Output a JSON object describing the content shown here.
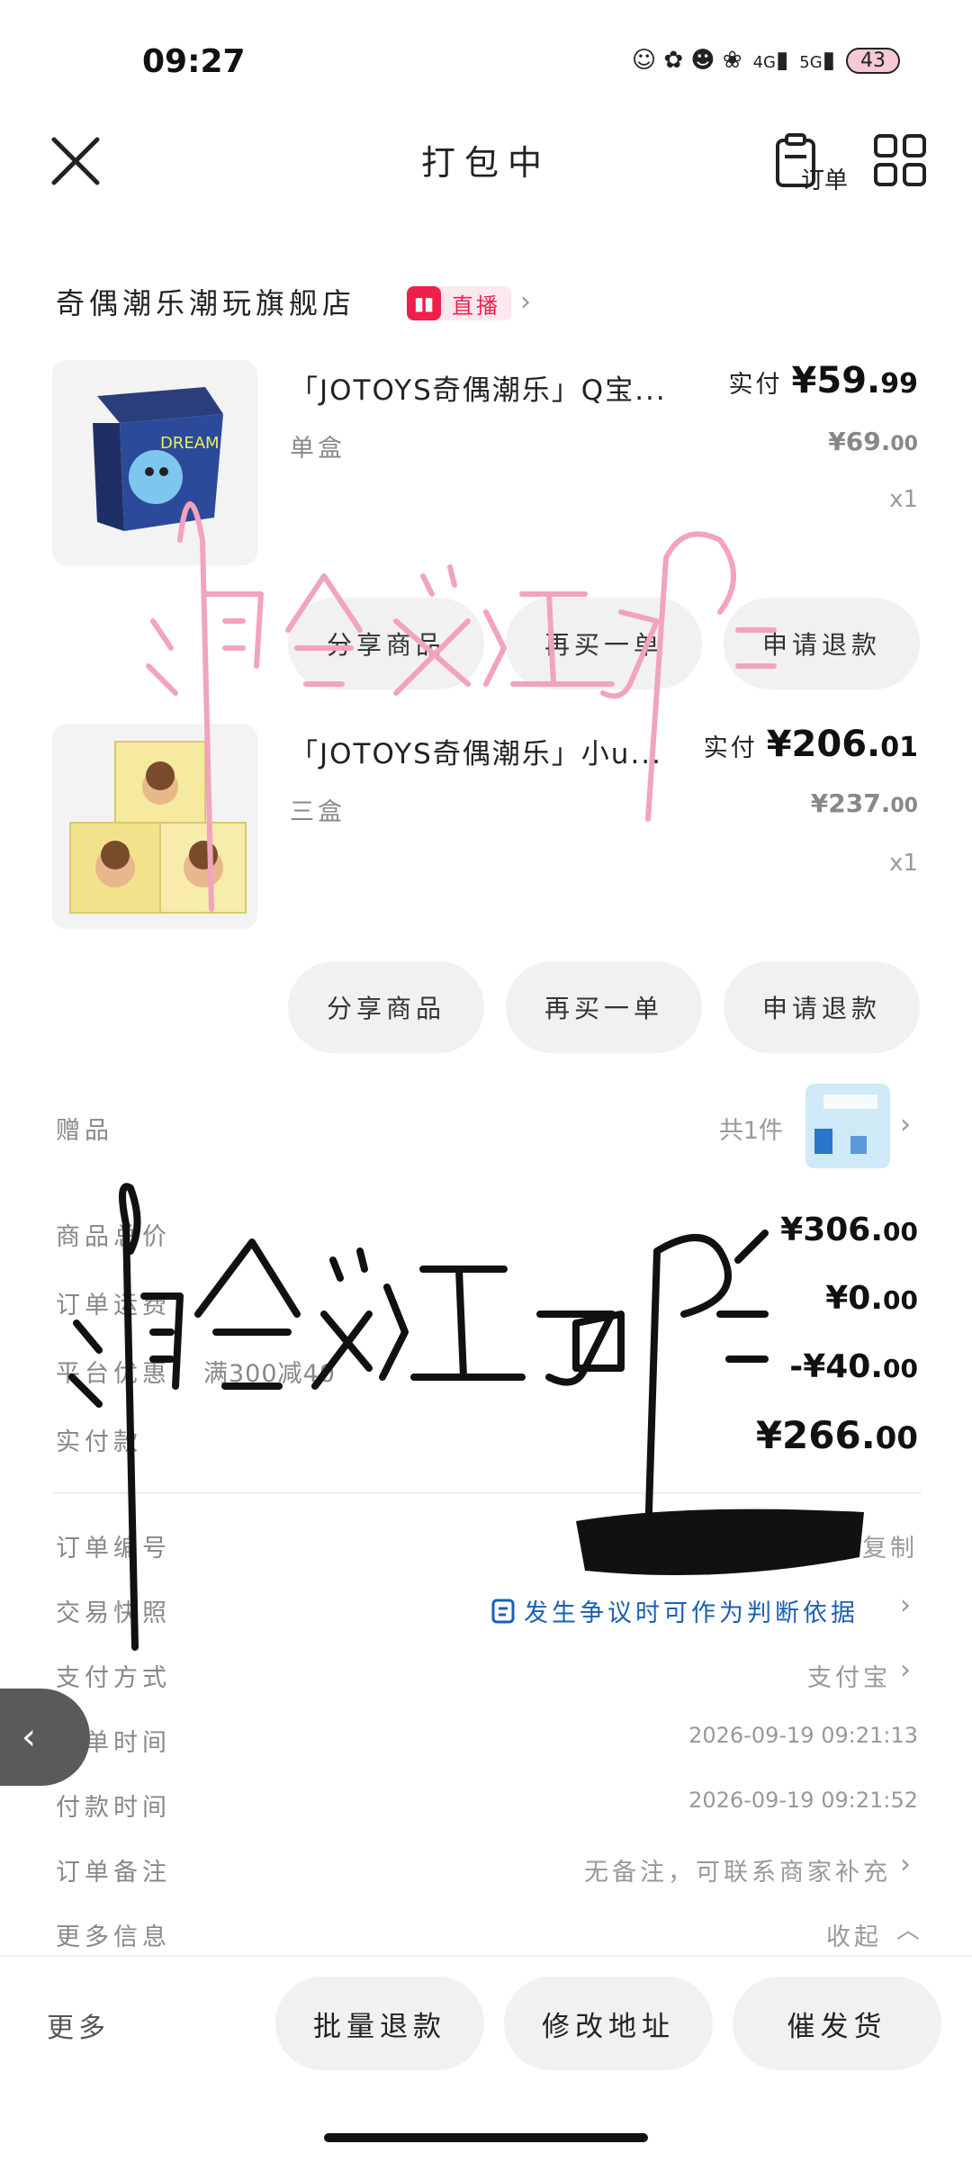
{
  "status_bar": {
    "time": "09:27",
    "signal1": "4G",
    "signal2": "5G",
    "battery": "43"
  },
  "nav": {
    "title": "打包中",
    "order_label": "订单"
  },
  "shop": {
    "name": "奇偶潮乐潮玩旗舰店",
    "live_label": "直播"
  },
  "products": [
    {
      "name": "「JOTOYS奇偶潮乐」Q宝...",
      "variant": "单盒",
      "paid_label": "实付",
      "paid_int": "¥59.",
      "paid_dec": "99",
      "orig_int": "¥69.",
      "orig_dec": "00",
      "qty": "x1"
    },
    {
      "name": "「JOTOYS奇偶潮乐」小u...",
      "variant": "三盒",
      "paid_label": "实付",
      "paid_int": "¥206.",
      "paid_dec": "01",
      "orig_int": "¥237.",
      "orig_dec": "00",
      "qty": "x1"
    }
  ],
  "product_actions": {
    "share": "分享商品",
    "rebuy": "再买一单",
    "refund": "申请退款"
  },
  "gift": {
    "label": "赠品",
    "count": "共1件"
  },
  "summary": {
    "goods_total_label": "商品总价",
    "goods_total_int": "¥306.",
    "goods_total_dec": "00",
    "shipping_label": "订单运费",
    "shipping_int": "¥0.",
    "shipping_dec": "00",
    "discount_label": "平台优惠",
    "discount_note": "满300减40",
    "discount_int": "-¥40.",
    "discount_dec": "00",
    "paid_label": "实付款",
    "paid_int": "¥266.",
    "paid_dec": "00"
  },
  "details": {
    "order_no_label": "订单编号",
    "copy": "复制",
    "snapshot_label": "交易快照",
    "snapshot_value": "发生争议时可作为判断依据",
    "pay_method_label": "支付方式",
    "pay_method_value": "支付宝",
    "order_time_label": "下单时间",
    "order_time_value": "2026-09-19 09:21:13",
    "pay_time_label": "付款时间",
    "pay_time_value": "2026-09-19 09:21:52",
    "remark_label": "订单备注",
    "remark_value": "无备注，可联系商家补充",
    "more_info_label": "更多信息",
    "collapse": "收起"
  },
  "bottom_bar": {
    "more": "更多",
    "batch_refund": "批量退款",
    "change_address": "修改地址",
    "urge_ship": "催发货"
  },
  "colors": {
    "accent": "#ef1f4d",
    "link_blue": "#1b5fb5",
    "pink_scribble": "#f2a3bd"
  }
}
